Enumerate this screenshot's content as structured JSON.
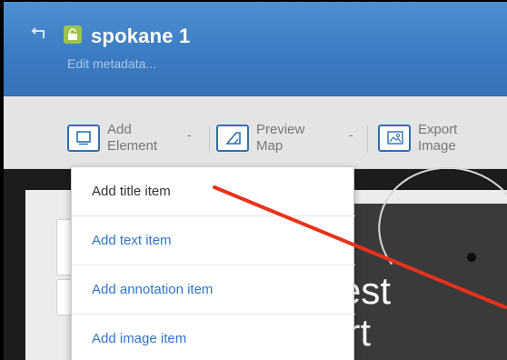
{
  "header": {
    "title": "spokane 1",
    "subtitle": "Edit metadata...",
    "back_icon": "back-arrow-icon",
    "lock_icon": "lock-icon",
    "accent": "#3c7cc2"
  },
  "toolbar": {
    "add_element": {
      "line1": "Add",
      "line2": "Element",
      "icon": "element-frame-icon"
    },
    "preview_map": {
      "line1": "Preview",
      "line2": "Map",
      "icon": "map-preview-icon"
    },
    "export_image": {
      "line1": "Export",
      "line2": "Image",
      "icon": "image-icon"
    }
  },
  "dropdown": {
    "items": [
      {
        "label": "Add title item"
      },
      {
        "label": "Add text item"
      },
      {
        "label": "Add annotation item"
      },
      {
        "label": "Add image item"
      }
    ]
  },
  "canvas": {
    "text_line1": "Quest",
    "text_line2": "ort"
  },
  "annotation": {
    "color": "#e8321c"
  }
}
